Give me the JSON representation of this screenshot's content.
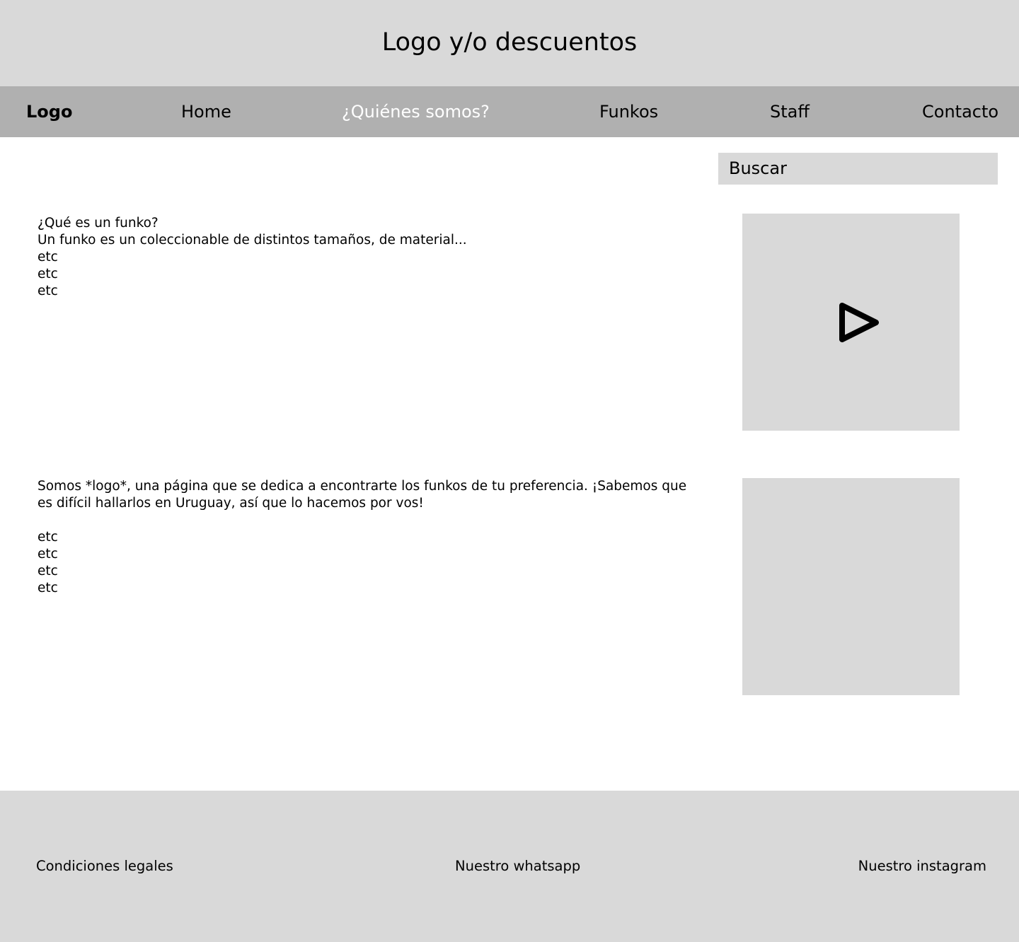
{
  "header": {
    "title": "Logo y/o descuentos"
  },
  "nav": {
    "logo": "Logo",
    "items": [
      "Home",
      "¿Quiénes somos?",
      "Funkos",
      "Staff",
      "Contacto"
    ],
    "active_color": "#ffffff"
  },
  "search": {
    "label": "Buscar"
  },
  "section1": {
    "lines": [
      "¿Qué es un funko?",
      "Un funko es un coleccionable de distintos tamaños, de material...",
      "etc",
      "etc",
      "etc"
    ],
    "media_icon": "play-icon"
  },
  "section2": {
    "lines": [
      "Somos *logo*, una página que se dedica a encontrarte los funkos de tu preferencia. ¡Sabemos que",
      "es difícil hallarlos en Uruguay, así que lo hacemos por vos!",
      "",
      "etc",
      "etc",
      "etc",
      "etc"
    ]
  },
  "footer": {
    "legal": "Condiciones legales",
    "whatsapp": "Nuestro whatsapp",
    "instagram": "Nuestro instagram"
  },
  "colors": {
    "panel": "#d9d9d9",
    "navbar": "#b0b0b0"
  }
}
